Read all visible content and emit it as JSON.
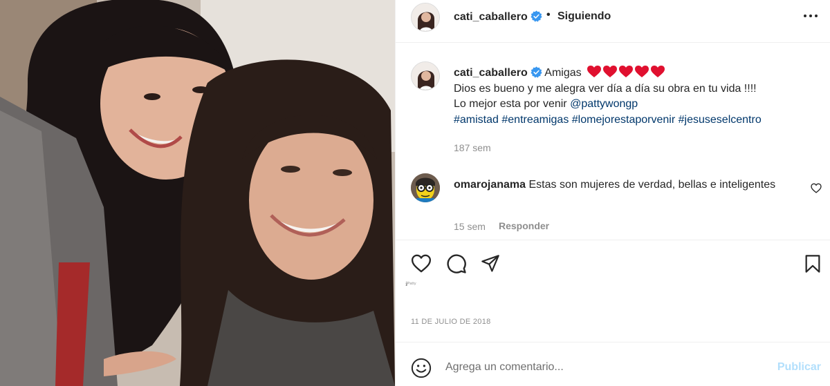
{
  "post": {
    "author": "cati_caballero",
    "follow_dot": "•",
    "follow_status": "Siguiendo",
    "caption": {
      "prefix": "Amigas",
      "line2": "Dios es bueno y me alegra ver día a día su obra en tu vida !!!!",
      "line3_text": "Lo mejor esta por venir ",
      "mention": "@pattywongp",
      "hashtags": [
        "#amistad",
        "#entreamigas",
        "#lomejorestaporvenir",
        "#jesuseselcentro"
      ],
      "time": "187 sem"
    },
    "comments": [
      {
        "author": "omarojanama",
        "text": "Estas son mujeres de verdad, bellas e inteligentes",
        "time": "15 sem",
        "reply_label": "Responder"
      }
    ],
    "liked_by_small_text": "ℹ︎ᴾᵃᵗᵗʸ",
    "date": "11 DE JULIO DE 2018",
    "add_comment": {
      "placeholder": "Agrega un comentario...",
      "publish_label": "Publicar"
    }
  },
  "colors": {
    "link": "#00376b",
    "muted": "#8e8e8e",
    "verified": "#3897f0",
    "publish_disabled": "#b2dffc",
    "heart": "#e0102f"
  },
  "icons": {
    "header": [
      "verified-icon",
      "more-options-icon"
    ],
    "actions": [
      "heart-icon",
      "comment-icon",
      "share-icon",
      "bookmark-icon"
    ],
    "footer": [
      "emoji-icon"
    ]
  }
}
